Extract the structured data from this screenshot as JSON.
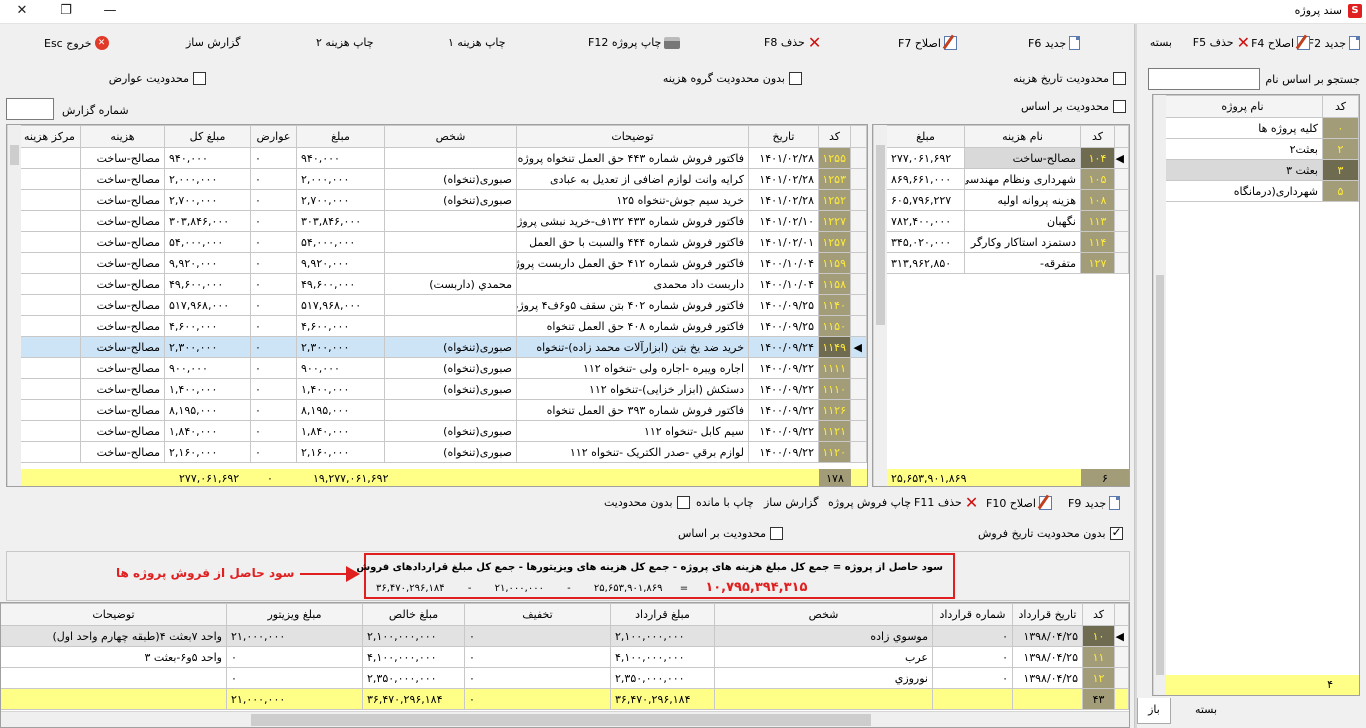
{
  "window": {
    "title": "سند پروژه",
    "min": "—",
    "max": "❐",
    "close": "✕"
  },
  "left_panel": {
    "toolbar": {
      "new": "جدید F2",
      "edit": "اصلاح F4",
      "delete": "حذف F5",
      "close": "بسته"
    },
    "search_label": "جستجو بر اساس نام",
    "columns": [
      "کد",
      "نام پروژه"
    ],
    "rows": [
      {
        "code": "۰",
        "name": "کلیه پروژه ها"
      },
      {
        "code": "۲",
        "name": "بعثت۲"
      },
      {
        "code": "۳",
        "name": "بعثت ۳"
      },
      {
        "code": "۵",
        "name": "شهرداری(درمانگاه"
      }
    ],
    "footer_count": "۴",
    "tabs": [
      "باز",
      "بسته"
    ]
  },
  "main_toolbar": {
    "new": "جدید F6",
    "edit": "اصلاح F7",
    "delete": "حذف F8",
    "print": "چاپ پروژه F12",
    "cost1": "چاپ هزینه ۱",
    "cost2": "چاپ هزینه ۲",
    "report": "گزارش ساز",
    "exit": "خروج Esc"
  },
  "filters": {
    "date_limit": "محدودیت تاریخ هزینه",
    "group_limit": "بدون محدودیت گروه هزینه",
    "tolls_limit": "محدودیت عوارض",
    "based_on": "محدودیت بر اساس",
    "report_no": "شماره گزارش"
  },
  "cost_summary": {
    "columns": [
      "کد",
      "نام هزینه",
      "مبلغ"
    ],
    "rows": [
      {
        "code": "۱۰۴",
        "name": "مصالح-ساخت",
        "amount": "۲۷۷,۰۶۱,۶۹۲"
      },
      {
        "code": "۱۰۵",
        "name": "شهرداری ونظام مهندسی",
        "amount": "۸۶۹,۶۶۱,۰۰۰"
      },
      {
        "code": "۱۰۸",
        "name": "هزینه پروانه اولیه",
        "amount": "۶۰۵,۷۹۶,۲۲۷"
      },
      {
        "code": "۱۱۳",
        "name": "نگهبان",
        "amount": "۷۸۲,۴۰۰,۰۰۰"
      },
      {
        "code": "۱۱۴",
        "name": "دستمزد استاکار وکارگر",
        "amount": "۳۴۵,۰۲۰,۰۰۰"
      },
      {
        "code": "۱۲۷",
        "name": "متفرقه-",
        "amount": "۳۱۳,۹۶۲,۸۵۰"
      }
    ],
    "footer_count": "۶",
    "footer_total": "۲۵,۶۵۳,۹۰۱,۸۶۹"
  },
  "cost_details": {
    "columns": [
      "کد",
      "تاریخ",
      "توضیحات",
      "شخص",
      "مبلغ",
      "عوارض",
      "مبلغ کل",
      "هزینه",
      "مرکز هزینه"
    ],
    "rows": [
      {
        "code": "۱۲۵۵",
        "date": "۱۴۰۱/۰۲/۲۸",
        "desc": "فاکتور فروش شماره ۴۴۳ حق العمل تنخواه پروژه",
        "person": "",
        "amount": "۹۴۰,۰۰۰",
        "toll": "۰",
        "total": "۹۴۰,۰۰۰",
        "cost": "مصالح-ساخت",
        "center": ""
      },
      {
        "code": "۱۲۵۳",
        "date": "۱۴۰۱/۰۲/۲۸",
        "desc": "کرایه وانت لوازم اضافی از تعدیل به عبادی",
        "person": "صبوری(تنخواه)",
        "amount": "۲,۰۰۰,۰۰۰",
        "toll": "۰",
        "total": "۲,۰۰۰,۰۰۰",
        "cost": "مصالح-ساخت",
        "center": ""
      },
      {
        "code": "۱۲۵۲",
        "date": "۱۴۰۱/۰۲/۲۸",
        "desc": "خرید سیم جوش-تنخواه ۱۲۵",
        "person": "صبوری(تنخواه)",
        "amount": "۲,۷۰۰,۰۰۰",
        "toll": "۰",
        "total": "۲,۷۰۰,۰۰۰",
        "cost": "مصالح-ساخت",
        "center": ""
      },
      {
        "code": "۱۲۲۷",
        "date": "۱۴۰۱/۰۲/۱۰",
        "desc": "فاکتور فروش شماره ۴۳۳ ۱۳۲ف-خرید نبشی پروژه",
        "person": "",
        "amount": "۳۰۳,۸۴۶,۰۰۰",
        "toll": "۰",
        "total": "۳۰۳,۸۴۶,۰۰۰",
        "cost": "مصالح-ساخت",
        "center": ""
      },
      {
        "code": "۱۲۵۷",
        "date": "۱۴۰۱/۰۲/۰۱",
        "desc": "فاکتور فروش شماره ۴۴۴ والسبت با حق العمل",
        "person": "",
        "amount": "۵۴,۰۰۰,۰۰۰",
        "toll": "۰",
        "total": "۵۴,۰۰۰,۰۰۰",
        "cost": "مصالح-ساخت",
        "center": ""
      },
      {
        "code": "۱۱۵۹",
        "date": "۱۴۰۰/۱۰/۰۴",
        "desc": "فاکتور فروش شماره ۴۱۲ حق العمل داربست پروژه",
        "person": "",
        "amount": "۹,۹۲۰,۰۰۰",
        "toll": "۰",
        "total": "۹,۹۲۰,۰۰۰",
        "cost": "مصالح-ساخت",
        "center": ""
      },
      {
        "code": "۱۱۵۸",
        "date": "۱۴۰۰/۱۰/۰۴",
        "desc": "داربست داد محمدی",
        "person": "محمدي (داربست)",
        "amount": "۴۹,۶۰۰,۰۰۰",
        "toll": "۰",
        "total": "۴۹,۶۰۰,۰۰۰",
        "cost": "مصالح-ساخت",
        "center": ""
      },
      {
        "code": "۱۱۴۰",
        "date": "۱۴۰۰/۰۹/۲۵",
        "desc": "فاکتور فروش شماره ۴۰۲ بتن سقف ۵و۶ف۴ پروژه",
        "person": "",
        "amount": "۵۱۷,۹۶۸,۰۰۰",
        "toll": "۰",
        "total": "۵۱۷,۹۶۸,۰۰۰",
        "cost": "مصالح-ساخت",
        "center": ""
      },
      {
        "code": "۱۱۵۰",
        "date": "۱۴۰۰/۰۹/۲۵",
        "desc": "فاکتور فروش شماره ۴۰۸ حق العمل تنخواه",
        "person": "",
        "amount": "۴,۶۰۰,۰۰۰",
        "toll": "۰",
        "total": "۴,۶۰۰,۰۰۰",
        "cost": "مصالح-ساخت",
        "center": ""
      },
      {
        "code": "۱۱۴۹",
        "date": "۱۴۰۰/۰۹/۲۴",
        "desc": "خرید ضد یخ بتن (ابزارآلات محمد زاده)-تنخواه",
        "person": "صبوری(تنخواه)",
        "amount": "۲,۳۰۰,۰۰۰",
        "toll": "۰",
        "total": "۲,۳۰۰,۰۰۰",
        "cost": "مصالح-ساخت",
        "center": ""
      },
      {
        "code": "۱۱۱۱",
        "date": "۱۴۰۰/۰۹/۲۲",
        "desc": "اجاره ویبره -اجاره ولی -تنخواه ۱۱۲",
        "person": "صبوری(تنخواه)",
        "amount": "۹۰۰,۰۰۰",
        "toll": "۰",
        "total": "۹۰۰,۰۰۰",
        "cost": "مصالح-ساخت",
        "center": ""
      },
      {
        "code": "۱۱۱۰",
        "date": "۱۴۰۰/۰۹/۲۲",
        "desc": "دستکش (ابزار خزایی)-تنخواه ۱۱۲",
        "person": "صبوری(تنخواه)",
        "amount": "۱,۴۰۰,۰۰۰",
        "toll": "۰",
        "total": "۱,۴۰۰,۰۰۰",
        "cost": "مصالح-ساخت",
        "center": ""
      },
      {
        "code": "۱۱۲۶",
        "date": "۱۴۰۰/۰۹/۲۲",
        "desc": "فاکتور فروش شماره ۳۹۳ حق العمل تنخواه",
        "person": "",
        "amount": "۸,۱۹۵,۰۰۰",
        "toll": "۰",
        "total": "۸,۱۹۵,۰۰۰",
        "cost": "مصالح-ساخت",
        "center": ""
      },
      {
        "code": "۱۱۲۱",
        "date": "۱۴۰۰/۰۹/۲۲",
        "desc": "سیم کابل -تنخواه ۱۱۲",
        "person": "صبوری(تنخواه)",
        "amount": "۱,۸۴۰,۰۰۰",
        "toll": "۰",
        "total": "۱,۸۴۰,۰۰۰",
        "cost": "مصالح-ساخت",
        "center": ""
      },
      {
        "code": "۱۱۲۰",
        "date": "۱۴۰۰/۰۹/۲۲",
        "desc": "لوازم برقي -صدر الکتریک -تنخواه ۱۱۲",
        "person": "صبوری(تنخواه)",
        "amount": "۲,۱۶۰,۰۰۰",
        "toll": "۰",
        "total": "۲,۱۶۰,۰۰۰",
        "cost": "مصالح-ساخت",
        "center": ""
      }
    ],
    "footer_count": "۱۷۸",
    "footer_amount": "۲۷۷,۰۶۱,۶۹۲",
    "footer_toll": "۰",
    "footer_total": "۱۹,۲۷۷,۰۶۱,۶۹۲"
  },
  "sales_toolbar": {
    "new": "جدید F9",
    "edit": "اصلاح F10",
    "delete": "حذف F11",
    "print": "چاپ فروش پروژه",
    "report": "گزارش ساز",
    "print_rem": "چاپ با مانده",
    "no_limit": "بدون محدودیت",
    "based_on": "محدودیت بر اساس",
    "no_date_limit": "بدون محدودیت تاریخ فروش"
  },
  "summary": {
    "line1": "سود حاصل از پروژه = جمع کل مبلغ هزینه های پروژه - جمع کل هزینه های ویزیتورها - جمع کل مبلغ قراردادهای فروش",
    "profit": "۱۰,۷۹۵,۳۹۴,۳۱۵",
    "eq": "=",
    "cost_total": "۲۵,۶۵۳,۹۰۱,۸۶۹",
    "visitor_total": "۲۱,۰۰۰,۰۰۰",
    "contract_total": "۳۶,۴۷۰,۲۹۶,۱۸۴",
    "annotation": "سود حاصل از فروش پروژه ها"
  },
  "contracts": {
    "columns": [
      "کد",
      "تاریخ قرارداد",
      "شماره قرارداد",
      "شخص",
      "مبلغ قرارداد",
      "تخفیف",
      "مبلغ خالص",
      "مبلغ ویزیتور",
      "توضیحات"
    ],
    "rows": [
      {
        "code": "۱۰",
        "date": "۱۳۹۸/۰۴/۲۵",
        "no": "۰",
        "person": "موسوي زاده",
        "amount": "۲,۱۰۰,۰۰۰,۰۰۰",
        "discount": "۰",
        "net": "۲,۱۰۰,۰۰۰,۰۰۰",
        "visitor": "۲۱,۰۰۰,۰۰۰",
        "desc": "واحد ۷بعثت ۴(طبقه چهارم واحد اول)"
      },
      {
        "code": "۱۱",
        "date": "۱۳۹۸/۰۴/۲۵",
        "no": "۰",
        "person": "عرب",
        "amount": "۴,۱۰۰,۰۰۰,۰۰۰",
        "discount": "۰",
        "net": "۴,۱۰۰,۰۰۰,۰۰۰",
        "visitor": "۰",
        "desc": "واحد ۵و۶-بعثت ۳"
      },
      {
        "code": "۱۲",
        "date": "۱۳۹۸/۰۴/۲۵",
        "no": "۰",
        "person": "نوروزي",
        "amount": "۲,۳۵۰,۰۰۰,۰۰۰",
        "discount": "۰",
        "net": "۲,۳۵۰,۰۰۰,۰۰۰",
        "visitor": "۰",
        "desc": ""
      }
    ],
    "footer_count": "۴۳",
    "footer_amount": "۳۶,۴۷۰,۲۹۶,۱۸۴",
    "footer_discount": "۰",
    "footer_net": "۳۶,۴۷۰,۲۹۶,۱۸۴",
    "footer_visitor": "۲۱,۰۰۰,۰۰۰"
  }
}
